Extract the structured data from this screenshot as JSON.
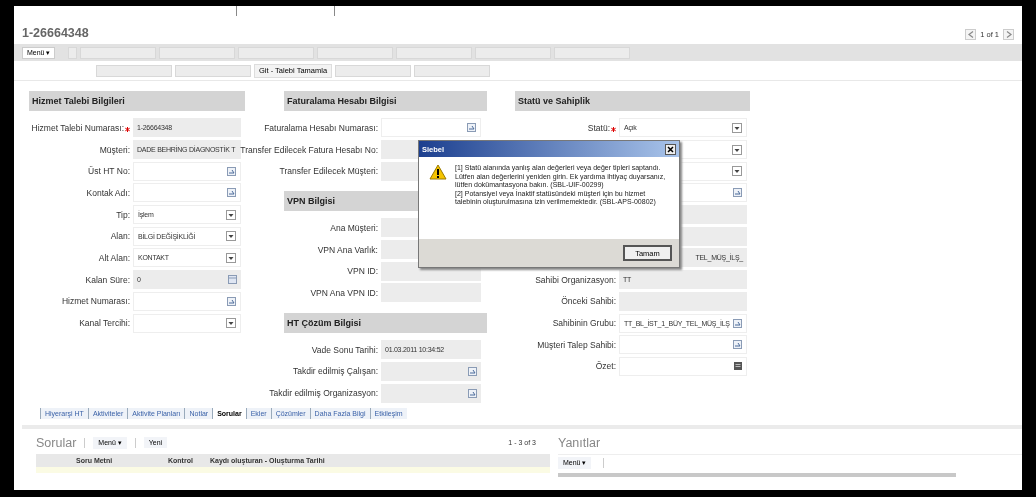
{
  "record_title": "1-26664348",
  "pager": "1 of 1",
  "toolbar": {
    "menu": "Menü ▾",
    "row_1": [
      {
        "disabled": true
      },
      {
        "disabled": true
      },
      {
        "disabled": true
      },
      {
        "disabled": true
      },
      {
        "disabled": true
      },
      {
        "disabled": true
      },
      {
        "disabled": true
      },
      {
        "disabled": true
      }
    ],
    "row_2": [
      {
        "disabled": true
      },
      {
        "disabled": true
      },
      {
        "disabled": false,
        "label": "Git - Talebi Tamamla"
      },
      {
        "disabled": true
      },
      {
        "disabled": true
      }
    ]
  },
  "columns": [
    {
      "sections": [
        {
          "title": "Hizmet Talebi Bilgileri",
          "fields": [
            {
              "label": "Hizmet Talebi Numarası:",
              "required": true,
              "kind": "readonly",
              "value": "1-26664348"
            },
            {
              "label": "Müşteri:",
              "required": false,
              "kind": "readonly",
              "value": "DADE BEHRİNG DİAGNOSTİK T"
            },
            {
              "label": "Üst HT No:",
              "required": false,
              "kind": "pick"
            },
            {
              "label": "Kontak Adı:",
              "required": false,
              "kind": "pick"
            },
            {
              "label": "Tip:",
              "required": false,
              "kind": "select",
              "value": "İşlem"
            },
            {
              "label": "Alan:",
              "required": false,
              "kind": "select",
              "value": "BİLGİ DEĞİŞİKLİĞİ"
            },
            {
              "label": "Alt Alan:",
              "required": false,
              "kind": "select",
              "value": "KONTAKT"
            },
            {
              "label": "Kalan Süre:",
              "required": false,
              "kind": "calendar",
              "value": "0"
            },
            {
              "label": "Hizmet Numarası:",
              "required": false,
              "kind": "pick"
            },
            {
              "label": "Kanal Tercihi:",
              "required": false,
              "kind": "select"
            }
          ]
        }
      ]
    },
    {
      "sections": [
        {
          "title": "Faturalama Hesabı Bilgisi",
          "fields": [
            {
              "label": "Faturalama Hesabı Numarası:",
              "required": false,
              "kind": "pick"
            },
            {
              "label": "Transfer Edilecek Fatura Hesabı No:",
              "required": false,
              "kind": "readonly"
            },
            {
              "label": "Transfer Edilecek Müşteri:",
              "required": false,
              "kind": "readonly"
            }
          ]
        },
        {
          "title": "VPN Bilgisi",
          "fields": [
            {
              "label": "Ana Müşteri:",
              "required": false,
              "kind": "readonly"
            },
            {
              "label": "VPN Ana Varlık:",
              "required": false,
              "kind": "readonly"
            },
            {
              "label": "VPN ID:",
              "required": false,
              "kind": "readonly"
            },
            {
              "label": "VPN Ana VPN ID:",
              "required": false,
              "kind": "readonly"
            }
          ]
        },
        {
          "title": "HT Çözüm Bilgisi",
          "fields": [
            {
              "label": "Vade Sonu Tarihi:",
              "required": false,
              "kind": "readonly",
              "value": "01.03.2011 10:34:52"
            },
            {
              "label": "Takdir edilmiş Çalışan:",
              "required": false,
              "kind": "pick-readonly"
            },
            {
              "label": "Takdir edilmiş Organizasyon:",
              "required": false,
              "kind": "pick-readonly"
            }
          ]
        }
      ]
    },
    {
      "sections": [
        {
          "title": "Statü ve Sahiplik",
          "fields": [
            {
              "label": "Statü:",
              "required": true,
              "kind": "select",
              "value": "Açık"
            },
            {
              "required": false,
              "kind": "select"
            },
            {
              "required": false,
              "kind": "select"
            },
            {
              "required": false,
              "kind": "pick"
            },
            {
              "required": false,
              "kind": "readonly"
            },
            {
              "required": false,
              "kind": "readonly"
            },
            {
              "required": false,
              "kind": "covered",
              "value": "TEL_MÜŞ_İLŞ_"
            },
            {
              "label": "Sahibi Organizasyon:",
              "required": false,
              "kind": "readonly",
              "value": "TT"
            },
            {
              "label": "Önceki Sahibi:",
              "required": false,
              "kind": "readonly"
            },
            {
              "label": "Sahibinin Grubu:",
              "required": false,
              "kind": "pick",
              "value": "TT_BL_İST_1_BÜY_TEL_MÜŞ_İLŞ"
            },
            {
              "label": "Müşteri Talep Sahibi:",
              "required": false,
              "kind": "pick"
            },
            {
              "label": "Özet:",
              "required": false,
              "kind": "note"
            }
          ]
        }
      ]
    }
  ],
  "dialog": {
    "title": "Siebel",
    "messages": [
      "[1] Statü alanında yanlış alan değerleri veya değer tipleri saptandı. Lütfen alan değerlerini yeniden girin. Ek yardıma ihtiyaç duyarsanız, lütfen dokümantasyona bakın. (SBL-UIF-00299)",
      "[2] Potansiyel veya İnaktif statüsündeki müşteri için bu hizmet talebinin oluşturulmasına izin verilmemektedir. (SBL-APS-00802)"
    ],
    "button": "Tamam"
  },
  "bottom_tabs": [
    {
      "label": "Hiyerarşi HT",
      "selected": false
    },
    {
      "label": "Aktiviteler",
      "selected": false
    },
    {
      "label": "Aktivite Planları",
      "selected": false
    },
    {
      "label": "Notlar",
      "selected": false
    },
    {
      "label": "Sorular",
      "selected": true
    },
    {
      "label": "Ekler",
      "selected": false
    },
    {
      "label": "Çözümler",
      "selected": false
    },
    {
      "label": "Daha Fazla Bilgi",
      "selected": false
    },
    {
      "label": "Etkileşim",
      "selected": false
    }
  ],
  "questions": {
    "title": "Sorular",
    "menu": "Menü ▾",
    "new_button": "Yeni",
    "count": "1 - 3 of 3",
    "columns": [
      "Soru Metni",
      "Kontrol",
      "Kaydı oluşturan - Oluşturma Tarihi"
    ]
  },
  "answers": {
    "title": "Yanıtlar",
    "menu": "Menü ▾"
  }
}
